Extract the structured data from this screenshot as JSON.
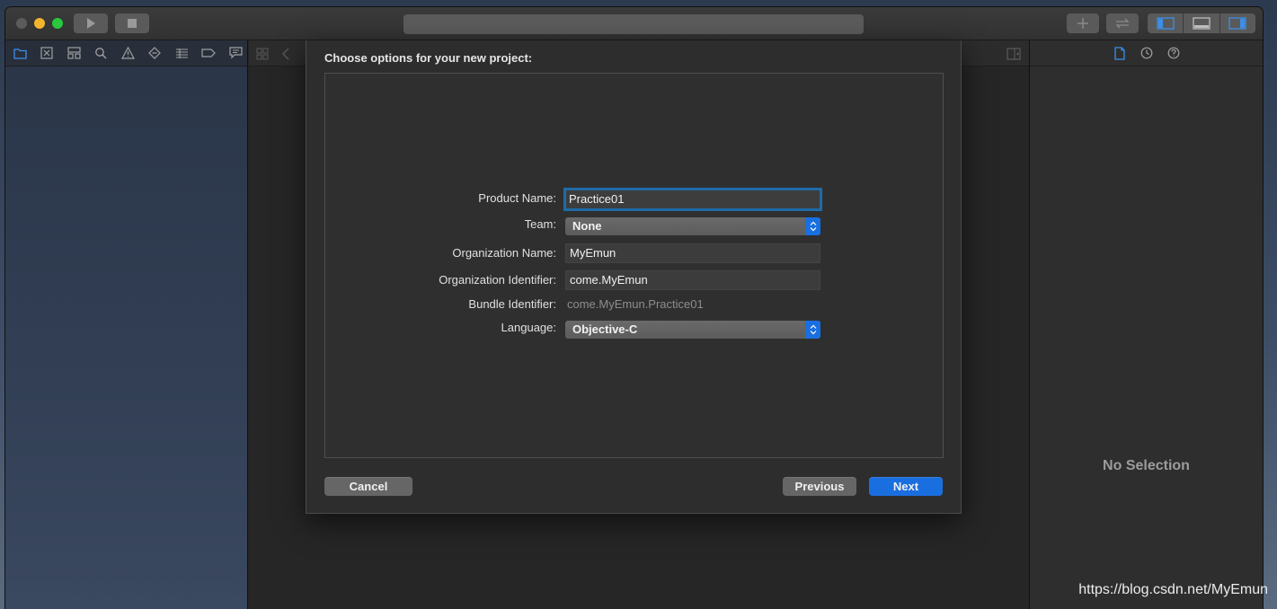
{
  "dialog": {
    "title": "Choose options for your new project:",
    "fields": {
      "product_name": {
        "label": "Product Name:",
        "value": "Practice01"
      },
      "team": {
        "label": "Team:",
        "value": "None"
      },
      "organization_name": {
        "label": "Organization Name:",
        "value": "MyEmun"
      },
      "organization_identifier": {
        "label": "Organization Identifier:",
        "value": "come.MyEmun"
      },
      "bundle_identifier": {
        "label": "Bundle Identifier:",
        "value": "come.MyEmun.Practice01"
      },
      "language": {
        "label": "Language:",
        "value": "Objective-C"
      }
    },
    "buttons": {
      "cancel": "Cancel",
      "previous": "Previous",
      "next": "Next"
    }
  },
  "inspector": {
    "empty_text": "No Selection"
  },
  "watermark": "https://blog.csdn.net/MyEmun",
  "colors": {
    "accent": "#1a6fe0",
    "focus_ring": "#1e6ba8",
    "nav_icon_active": "#3d8fe8"
  }
}
